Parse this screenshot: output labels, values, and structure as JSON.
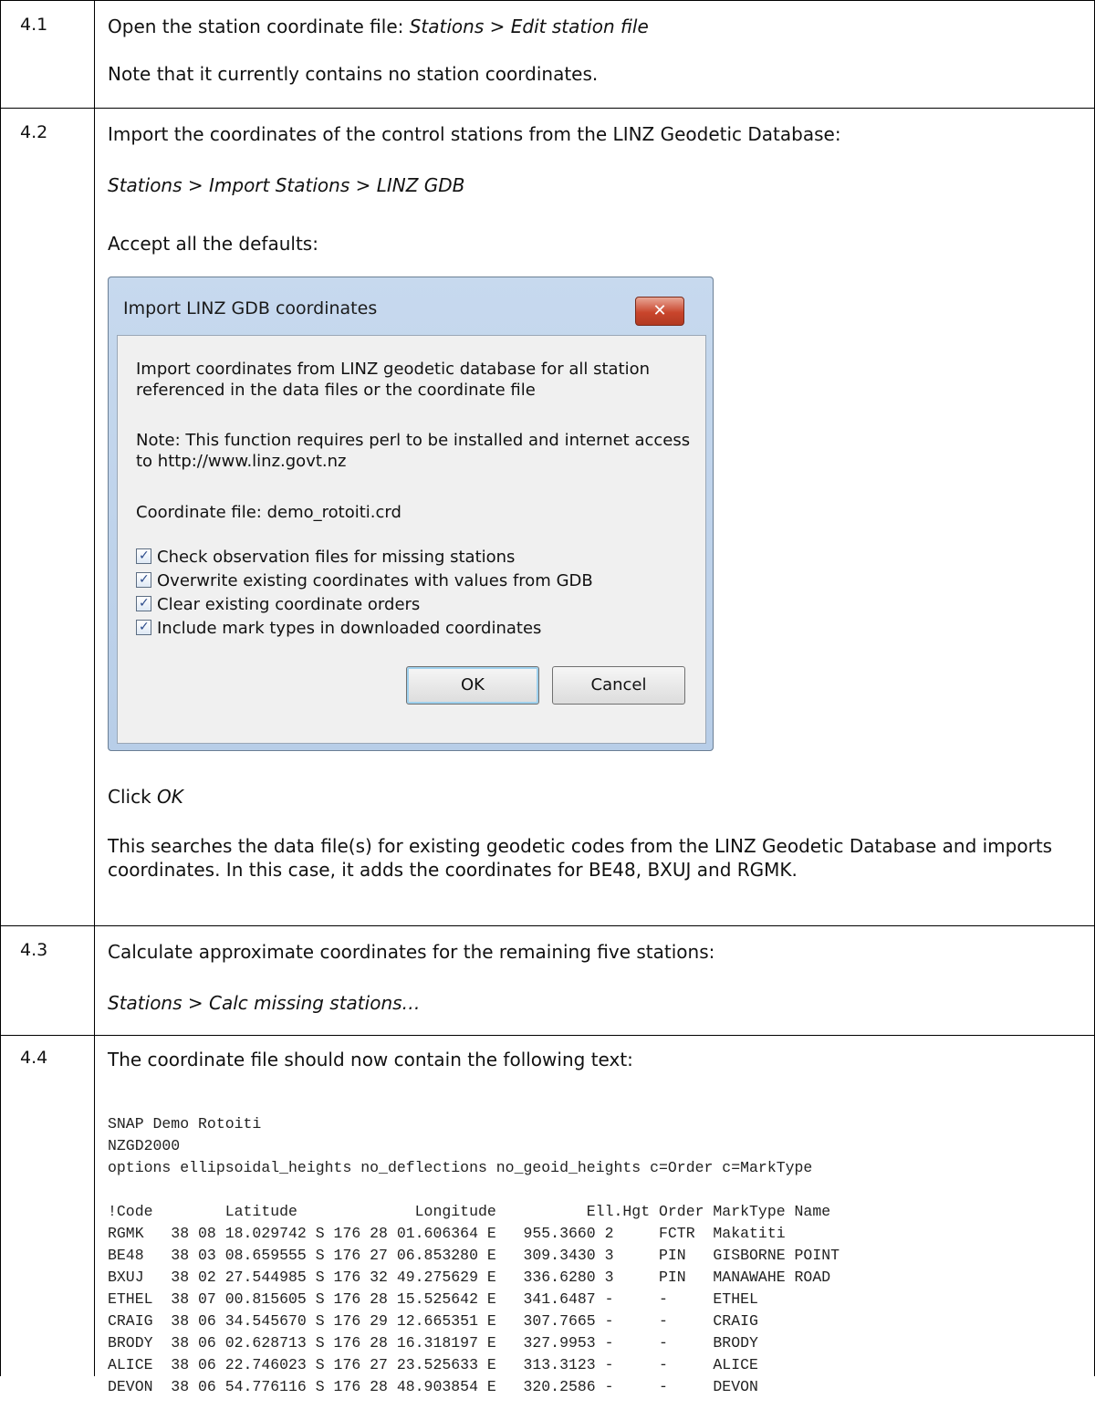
{
  "steps": [
    {
      "num": "4.1",
      "lines": [
        {
          "text": "Open the station coordinate file: ",
          "italic": "Stations > Edit station file"
        },
        {
          "text": "Note that it currently contains no station coordinates."
        }
      ]
    },
    {
      "num": "4.2",
      "intro": "Import the coordinates of the control stations from the LINZ Geodetic Database:",
      "menu_path": "Stations > Import Stations > LINZ GDB",
      "accept": "Accept all the defaults:",
      "click_prefix": "Click ",
      "click_target": "OK",
      "result_text": "This searches the data file(s) for existing geodetic codes from the LINZ Geodetic Database and imports coordinates. In this case, it adds the coordinates for BE48, BXUJ and RGMK."
    },
    {
      "num": "4.3",
      "intro": "Calculate approximate coordinates for the remaining five stations:",
      "menu_path": "Stations > Calc missing stations…"
    },
    {
      "num": "4.4",
      "intro": "The coordinate file should now contain the following text:"
    }
  ],
  "dialog": {
    "title": "Import LINZ GDB coordinates",
    "close_glyph": "✕",
    "desc": "Import coordinates from LINZ geodetic database for all station referenced in the data files or the coordinate file",
    "note": "Note: This function requires perl to be installed and internet access to http://www.linz.govt.nz",
    "coord_file": "Coordinate file: demo_rotoiti.crd",
    "checkboxes": [
      {
        "label": "Check observation files for missing stations",
        "checked": true
      },
      {
        "label": "Overwrite existing coordinates with values from GDB",
        "checked": true
      },
      {
        "label": "Clear existing coordinate orders",
        "checked": true
      },
      {
        "label": "Include mark types in downloaded coordinates",
        "checked": true
      }
    ],
    "ok_label": "OK",
    "cancel_label": "Cancel"
  },
  "listing": {
    "header_lines": [
      "SNAP Demo Rotoiti",
      "NZGD2000",
      "options ellipsoidal_heights no_deflections no_geoid_heights c=Order c=MarkType"
    ],
    "column_header": "!Code        Latitude             Longitude          Ell.Hgt Order MarkType Name",
    "rows": [
      "RGMK   38 08 18.029742 S 176 28 01.606364 E   955.3660 2     FCTR  Makatiti",
      "BE48   38 03 08.659555 S 176 27 06.853280 E   309.3430 3     PIN   GISBORNE POINT",
      "BXUJ   38 02 27.544985 S 176 32 49.275629 E   336.6280 3     PIN   MANAWAHE ROAD",
      "ETHEL  38 07 00.815605 S 176 28 15.525642 E   341.6487 -     -     ETHEL",
      "CRAIG  38 06 34.545670 S 176 29 12.665351 E   307.7665 -     -     CRAIG",
      "BRODY  38 06 02.628713 S 176 28 16.318197 E   327.9953 -     -     BRODY",
      "ALICE  38 06 22.746023 S 176 27 23.525633 E   313.3123 -     -     ALICE",
      "DEVON  38 06 54.776116 S 176 28 48.903854 E   320.2586 -     -     DEVON"
    ]
  }
}
